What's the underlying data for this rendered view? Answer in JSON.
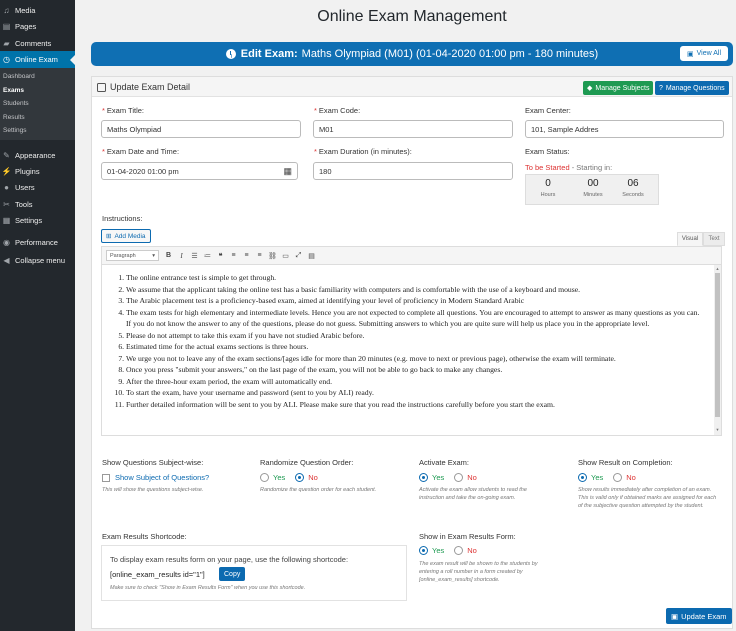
{
  "sidebar": {
    "items": [
      {
        "label": "Media",
        "icon": "media-icon"
      },
      {
        "label": "Pages",
        "icon": "pages-icon"
      },
      {
        "label": "Comments",
        "icon": "comments-icon"
      },
      {
        "label": "Online Exam",
        "icon": "online-exam-icon"
      },
      {
        "label": "Appearance",
        "icon": "appearance-icon"
      },
      {
        "label": "Plugins",
        "icon": "plugins-icon"
      },
      {
        "label": "Users",
        "icon": "users-icon"
      },
      {
        "label": "Tools",
        "icon": "tools-icon"
      },
      {
        "label": "Settings",
        "icon": "settings-icon"
      },
      {
        "label": "Performance",
        "icon": "performance-icon"
      },
      {
        "label": "Collapse menu",
        "icon": "collapse-icon"
      }
    ],
    "submenu": [
      "Dashboard",
      "Exams",
      "Students",
      "Results",
      "Settings"
    ]
  },
  "page_title": "Online Exam Management",
  "edit_bar": {
    "prefix": "Edit Exam:",
    "text": "Maths Olympiad (M01) (01-04-2020 01:00 pm - 180 minutes)",
    "view_all": "View All"
  },
  "panel": {
    "title": "Update Exam Detail",
    "manage_subjects": "Manage Subjects",
    "manage_questions": "Manage Questions"
  },
  "form": {
    "exam_title_label": "Exam Title:",
    "exam_title_value": "Maths Olympiad",
    "exam_code_label": "Exam Code:",
    "exam_code_value": "M01",
    "exam_center_label": "Exam Center:",
    "exam_center_value": "101, Sample Addres",
    "date_label": "Exam Date and Time:",
    "date_value": "01-04-2020 01:00 pm",
    "duration_label": "Exam Duration (in minutes):",
    "duration_value": "180",
    "status_label": "Exam Status:",
    "status_value": "To be Started",
    "status_suffix": "- Starting in:",
    "countdown": [
      {
        "value": "0",
        "unit": "Hours"
      },
      {
        "value": "00",
        "unit": "Minutes"
      },
      {
        "value": "06",
        "unit": "Seconds"
      }
    ]
  },
  "editor": {
    "label": "Instructions:",
    "add_media": "Add Media",
    "tab_visual": "Visual",
    "tab_text": "Text",
    "paragraph": "Paragraph",
    "items": [
      "The online entrance test is simple to get through.",
      "We assume that the applicant taking the online test has a basic familiarity with computers and is comfortable with the use of a keyboard and mouse.",
      "The Arabic placement test is a proficiency-based exam, aimed at identifying your level of proficiency in Modern Standard Arabic",
      "The exam tests for high elementary and intermediate levels. Hence you are not expected to complete all questions. You are encouraged to attempt to answer as many questions as you can. If you do not know the answer to any of the questions, please do not guess. Submitting answers to which you are quite sure will help us place you in the appropriate level.",
      "Please do not attempt to take this exam if you have not studied Arabic before.",
      "Estimated time for the actual exams sections is three hours.",
      "We urge you not to leave any of the exam sections/[ages idle for more than 20 minutes (e.g. move to next or previous page), otherwise the exam will terminate.",
      "Once you press \"submit your answers,\" on the last page of the exam, you will not be able to go back to make any changes.",
      "After the three-hour exam period, the exam will automatically end.",
      "To start the exam, have your username and password (sent to you by ALI) ready.",
      "Further detailed information will be sent to you by ALI. Please make sure that you read the instructions carefully before you start the exam."
    ]
  },
  "options": {
    "subject_wise_label": "Show Questions Subject-wise:",
    "subject_wise_checkbox": "Show Subject of Questions?",
    "subject_wise_help": "This will show the questions subject-wise.",
    "randomize_label": "Randomize Question Order:",
    "randomize_help": "Randomize the question order for each student.",
    "activate_label": "Activate Exam:",
    "activate_help": "Activate the exam allow students to read the instruction and take the on-going exam.",
    "show_result_label": "Show Result on Completion:",
    "show_result_help": "Show results immediately after completion of an exam. This is valid only if obtained marks are assigned for each of the subjective question attempted by the student.",
    "yes": "Yes",
    "no": "No",
    "shortcode_label": "Exam Results Shortcode:",
    "shortcode_intro": "To display exam results form on your page, use the following shortcode:",
    "shortcode": "[online_exam_results id=\"1\"]",
    "copy": "Copy",
    "shortcode_note": "Make sure to check \"Show in Exam Results Form\" when you use this shortcode.",
    "results_form_label": "Show in Exam Results Form:",
    "results_form_help": "The exam result will be shown to the students by entering a roll number in a form created by [online_exam_results] shortcode."
  },
  "update_button": "Update Exam",
  "colors": {
    "accent": "#0f6fb3",
    "success": "#1e9a52",
    "danger": "#dd3333",
    "sidebar": "#23282d"
  }
}
